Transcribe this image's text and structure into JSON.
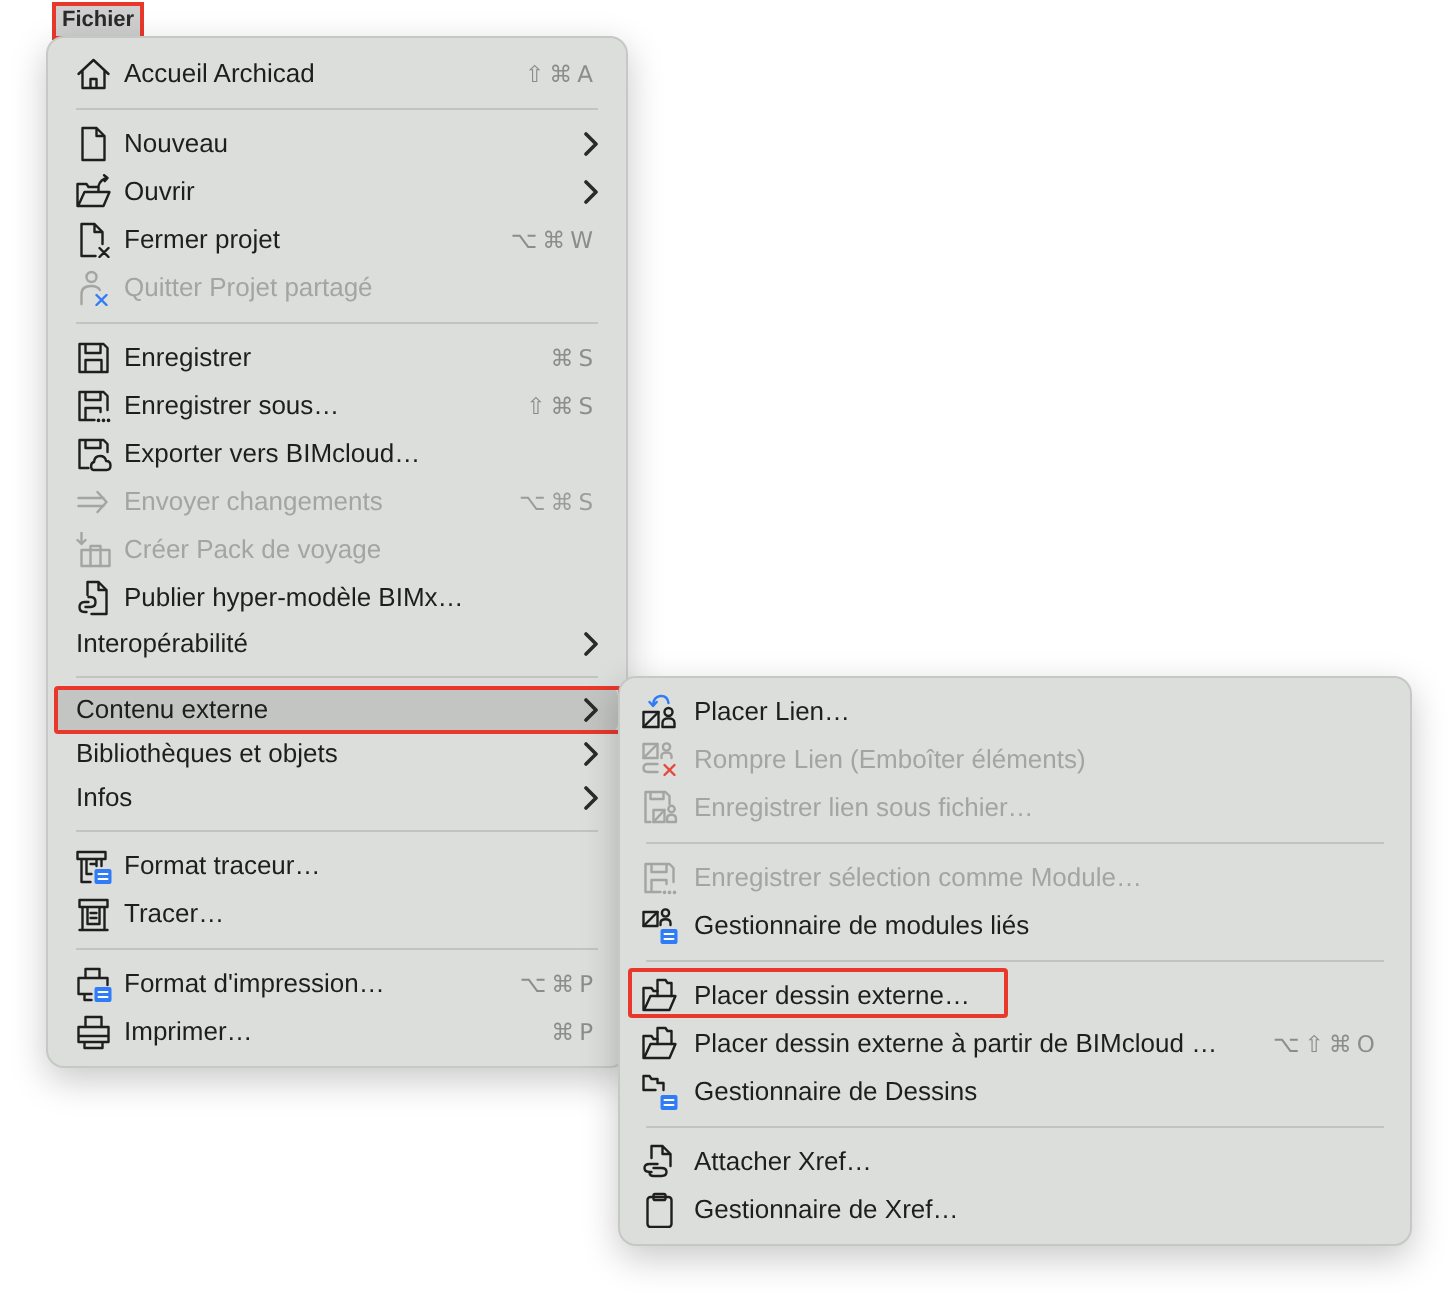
{
  "menu_title": {
    "label": "Fichier",
    "selected": true,
    "framed": true
  },
  "menu": {
    "sections": [
      {
        "items": [
          {
            "label": "Accueil Archicad",
            "shortcut": "⇧⌘A",
            "disabled": false,
            "selected": false,
            "framed": false,
            "has_submenu": false
          }
        ]
      },
      {
        "items": [
          {
            "label": "Nouveau",
            "disabled": false,
            "selected": false,
            "framed": false,
            "has_submenu": true
          },
          {
            "label": "Ouvrir",
            "disabled": false,
            "selected": false,
            "framed": false,
            "has_submenu": true
          },
          {
            "label": "Fermer projet",
            "shortcut": "⌥⌘W",
            "disabled": false,
            "selected": false,
            "framed": false,
            "has_submenu": false
          },
          {
            "label": "Quitter Projet partagé",
            "disabled": true,
            "selected": false,
            "framed": false,
            "has_submenu": false
          }
        ]
      },
      {
        "items": [
          {
            "label": "Enregistrer",
            "shortcut": "⌘S",
            "disabled": false,
            "selected": false,
            "framed": false,
            "has_submenu": false
          },
          {
            "label": "Enregistrer sous…",
            "shortcut": "⇧⌘S",
            "disabled": false,
            "selected": false,
            "framed": false,
            "has_submenu": false
          },
          {
            "label": "Exporter vers BIMcloud…",
            "disabled": false,
            "selected": false,
            "framed": false,
            "has_submenu": false
          },
          {
            "label": "Envoyer changements",
            "shortcut": "⌥⌘S",
            "disabled": true,
            "selected": false,
            "framed": false,
            "has_submenu": false
          },
          {
            "label": "Créer Pack de voyage",
            "disabled": true,
            "selected": false,
            "framed": false,
            "has_submenu": false
          },
          {
            "label": "Publier hyper-modèle BIMx…",
            "disabled": false,
            "selected": false,
            "framed": false,
            "has_submenu": false
          },
          {
            "label": "Interopérabilité",
            "disabled": false,
            "selected": false,
            "framed": false,
            "has_submenu": true
          }
        ]
      },
      {
        "items": [
          {
            "label": "Contenu externe",
            "disabled": false,
            "selected": true,
            "framed": true,
            "has_submenu": true
          },
          {
            "label": "Bibliothèques et objets",
            "disabled": false,
            "selected": false,
            "framed": false,
            "has_submenu": true
          },
          {
            "label": "Infos",
            "disabled": false,
            "selected": false,
            "framed": false,
            "has_submenu": true
          }
        ]
      },
      {
        "items": [
          {
            "label": "Format traceur…",
            "disabled": false,
            "selected": false,
            "framed": false,
            "has_submenu": false
          },
          {
            "label": "Tracer…",
            "disabled": false,
            "selected": false,
            "framed": false,
            "has_submenu": false
          }
        ]
      },
      {
        "items": [
          {
            "label": "Format d'impression…",
            "shortcut": "⌥⌘P",
            "disabled": false,
            "selected": false,
            "framed": false,
            "has_submenu": false
          },
          {
            "label": "Imprimer…",
            "shortcut": "⌘P",
            "disabled": false,
            "selected": false,
            "framed": false,
            "has_submenu": false
          }
        ]
      }
    ]
  },
  "submenu": {
    "sections": [
      {
        "items": [
          {
            "label": "Placer Lien…",
            "disabled": false,
            "selected": false,
            "framed": false
          },
          {
            "label": "Rompre Lien (Emboîter éléments)",
            "disabled": true,
            "selected": false,
            "framed": false
          },
          {
            "label": "Enregistrer lien sous fichier…",
            "disabled": true,
            "selected": false,
            "framed": false
          }
        ]
      },
      {
        "items": [
          {
            "label": "Enregistrer sélection comme Module…",
            "disabled": true,
            "selected": false,
            "framed": false
          },
          {
            "label": "Gestionnaire de modules liés",
            "disabled": false,
            "selected": false,
            "framed": false
          }
        ]
      },
      {
        "items": [
          {
            "label": "Placer dessin externe…",
            "disabled": false,
            "selected": false,
            "framed": true
          },
          {
            "label": "Placer dessin externe à partir de BIMcloud …",
            "shortcut": "⌥⇧⌘O",
            "disabled": false,
            "selected": false,
            "framed": false
          },
          {
            "label": "Gestionnaire de Dessins",
            "disabled": false,
            "selected": false,
            "framed": false
          }
        ]
      },
      {
        "items": [
          {
            "label": "Attacher Xref…",
            "disabled": false,
            "selected": false,
            "framed": false
          },
          {
            "label": "Gestionnaire de Xref…",
            "disabled": false,
            "selected": false,
            "framed": false
          }
        ]
      }
    ]
  }
}
